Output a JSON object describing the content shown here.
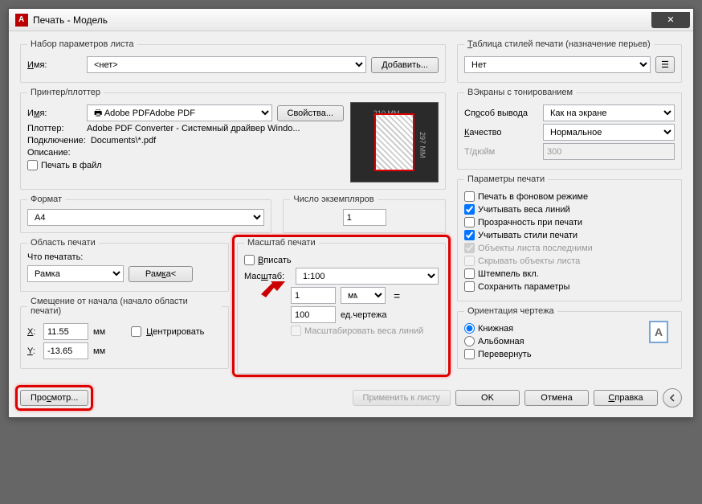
{
  "window": {
    "title": "Печать - Модель"
  },
  "pageSetup": {
    "legend": "Набор параметров листа",
    "nameLabel": "Имя:",
    "nameValue": "<нет>",
    "addButton": "Добавить..."
  },
  "plotStyles": {
    "legend": "Таблица стилей печати (назначение перьев)",
    "value": "Нет"
  },
  "printer": {
    "legend": "Принтер/плоттер",
    "nameLabel": "Имя:",
    "nameValue": "Adobe PDF",
    "propertiesButton": "Свойства...",
    "plotterLabel": "Плоттер:",
    "plotterValue": "Adobe PDF Converter - Системный драйвер Windo...",
    "connectionLabel": "Подключение:",
    "connectionValue": "Documents\\*.pdf",
    "descriptionLabel": "Описание:",
    "printToFile": "Печать в файл",
    "previewWidth": "210 MM",
    "previewHeight": "297 MM"
  },
  "shaded": {
    "legend": "ВЭкраны с тонированием",
    "methodLabel": "Способ вывода",
    "methodValue": "Как на экране",
    "qualityLabel": "Качество",
    "qualityValue": "Нормальное",
    "dpiLabel": "Т/дюйм",
    "dpiValue": "300"
  },
  "options": {
    "legend": "Параметры печати",
    "background": "Печать в фоновом режиме",
    "lineWeights": "Учитывать веса линий",
    "transparency": "Прозрачность при печати",
    "plotStyles": "Учитывать стили печати",
    "paperspaceLast": "Объекты листа последними",
    "hideObjects": "Скрывать объекты листа",
    "stampOn": "Штемпель вкл.",
    "saveChanges": "Сохранить параметры"
  },
  "format": {
    "legend": "Формат",
    "value": "A4"
  },
  "copies": {
    "legend": "Число экземпляров",
    "value": "1"
  },
  "plotArea": {
    "legend": "Область печати",
    "whatLabel": "Что печатать:",
    "value": "Рамка",
    "windowButton": "Рамка<"
  },
  "scale": {
    "legend": "Масштаб печати",
    "fit": "Вписать",
    "scaleLabel": "Масштаб:",
    "scaleValue": "1:100",
    "unitValue": "1",
    "unitType": "мм",
    "drawingValue": "100",
    "drawingLabel": "ед.чертежа",
    "scaleLineweights": "Масштабировать веса линий"
  },
  "offset": {
    "legend": "Смещение от начала (начало области печати)",
    "xLabel": "X:",
    "xValue": "11.55",
    "yLabel": "Y:",
    "yValue": "-13.65",
    "unit": "мм",
    "center": "Центрировать"
  },
  "orientation": {
    "legend": "Ориентация чертежа",
    "portrait": "Книжная",
    "landscape": "Альбомная",
    "upsideDown": "Перевернуть"
  },
  "footer": {
    "preview": "Просмотр...",
    "applyLayout": "Применить к листу",
    "ok": "OK",
    "cancel": "Отмена",
    "help": "Справка"
  }
}
